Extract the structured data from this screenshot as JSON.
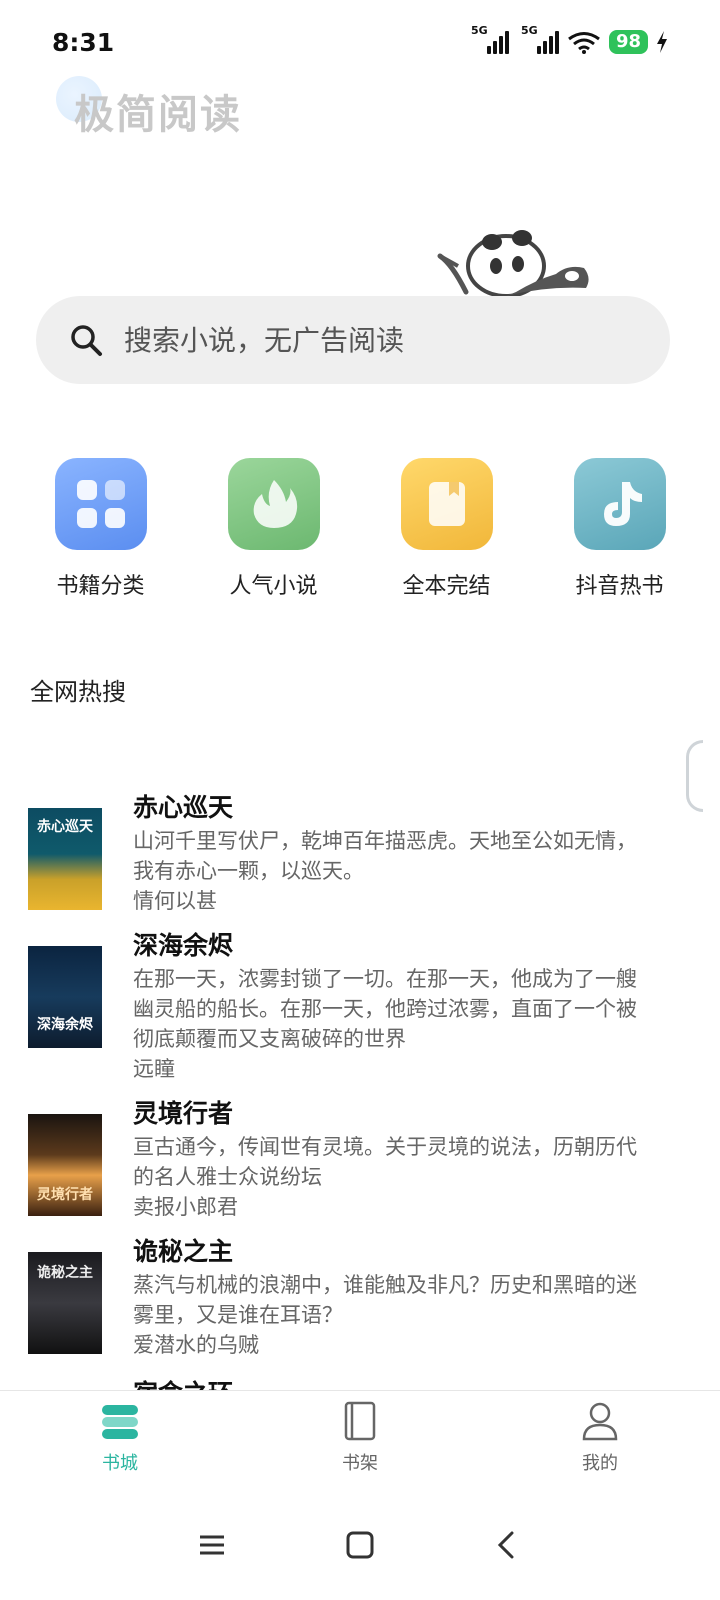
{
  "status_bar": {
    "time": "8:31",
    "signal1": "5G",
    "signal2": "5G",
    "battery": "98"
  },
  "header": {
    "brand": "极简阅读"
  },
  "search": {
    "placeholder": "搜索小说，无广告阅读"
  },
  "categories": [
    {
      "label": "书籍分类",
      "icon": "grid-icon",
      "color": "#6b9cf5"
    },
    {
      "label": "人气小说",
      "icon": "flame-icon",
      "color": "#7cc27f"
    },
    {
      "label": "全本完结",
      "icon": "book-icon",
      "color": "#f4c24a"
    },
    {
      "label": "抖音热书",
      "icon": "tiktok-icon",
      "color": "#6fb5c6"
    }
  ],
  "section": {
    "title": "全网热搜"
  },
  "books": [
    {
      "title": "赤心巡天",
      "desc_lines": [
        "山河千里写伏尸，乾坤百年描恶虎。天地至公如无情，",
        "我有赤心一颗，以巡天。"
      ],
      "author": "情何以甚",
      "cover_text": "赤心巡天"
    },
    {
      "title": "深海余烬",
      "desc_lines": [
        "在那一天，浓雾封锁了一切。在那一天，他成为了一艘",
        "幽灵船的船长。在那一天，他跨过浓雾，直面了一个被",
        "彻底颠覆而又支离破碎的世界"
      ],
      "author": "远瞳",
      "cover_text": "深海余烬"
    },
    {
      "title": "灵境行者",
      "desc_lines": [
        "亘古通今，传闻世有灵境。关于灵境的说法，历朝历代",
        "的名人雅士众说纷坛"
      ],
      "author": "卖报小郎君",
      "cover_text": "灵境行者"
    },
    {
      "title": "诡秘之主",
      "desc_lines": [
        "蒸汽与机械的浪潮中，谁能触及非凡？历史和黑暗的迷",
        "雾里，又是谁在耳语？"
      ],
      "author": "爱潜水的乌贼",
      "cover_text": "诡秘之主"
    }
  ],
  "partial_next_title": "宿命之环",
  "bottom_nav": [
    {
      "label": "书城",
      "icon": "bookstore-icon",
      "active": true
    },
    {
      "label": "书架",
      "icon": "bookshelf-icon",
      "active": false
    },
    {
      "label": "我的",
      "icon": "profile-icon",
      "active": false
    }
  ],
  "colors": {
    "accent": "#2bb5a0",
    "battery": "#2fc25b"
  }
}
